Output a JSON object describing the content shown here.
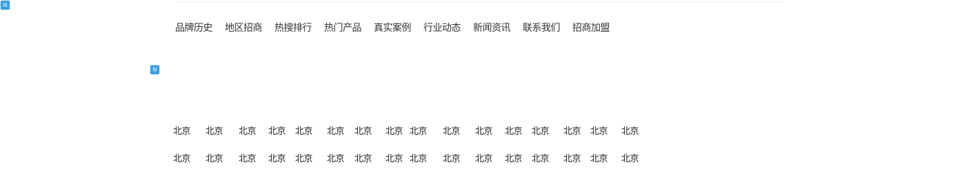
{
  "badges": {
    "top_left": "N",
    "middle": "N"
  },
  "nav": {
    "items": [
      {
        "label": "品牌历史"
      },
      {
        "label": "地区招商"
      },
      {
        "label": "热搜排行"
      },
      {
        "label": "热门产品"
      },
      {
        "label": "真实案例"
      },
      {
        "label": "行业动态"
      },
      {
        "label": "新闻资讯"
      },
      {
        "label": "联系我们"
      },
      {
        "label": "招商加盟"
      }
    ]
  },
  "city_rows": [
    {
      "cities": [
        "北京",
        "北京",
        "北京",
        "北京",
        "北京",
        "北京",
        "北京",
        "北京",
        "北京",
        "北京",
        "北京",
        "北京",
        "北京",
        "北京",
        "北京",
        "北京"
      ]
    },
    {
      "cities": [
        "北京",
        "北京",
        "北京",
        "北京",
        "北京",
        "北京",
        "北京",
        "北京",
        "北京",
        "北京",
        "北京",
        "北京",
        "北京",
        "北京",
        "北京",
        "北京"
      ]
    }
  ],
  "colors": {
    "badge": "#3aa0de",
    "text": "#333333"
  }
}
